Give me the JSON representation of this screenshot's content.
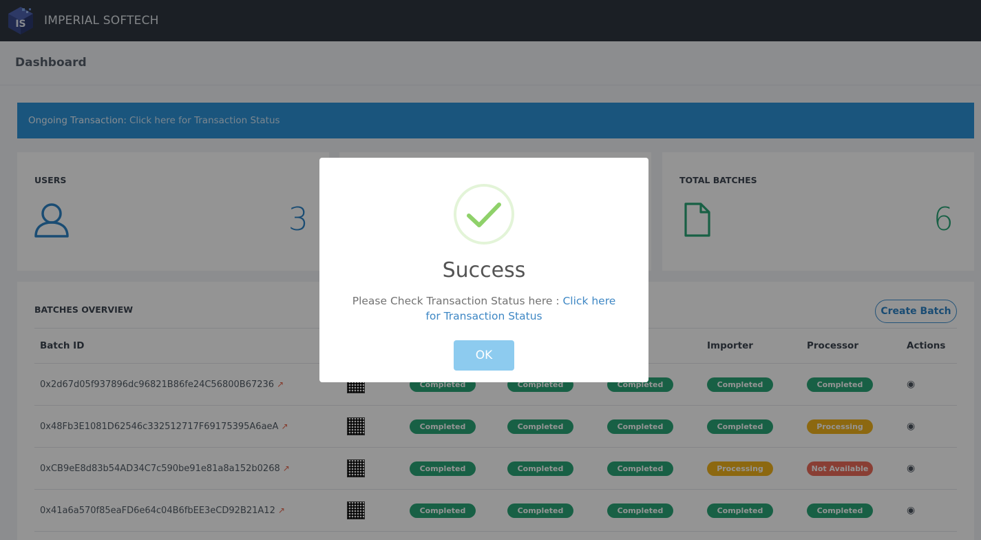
{
  "app": {
    "brand": "IMPERIAL SOFTECH",
    "logo_text": "IS"
  },
  "page": {
    "title": "Dashboard"
  },
  "alert": {
    "label": "Ongoing Transaction:",
    "link": "Click here for Transaction Status"
  },
  "stats": {
    "users": {
      "title": "USERS",
      "value": "3",
      "icon": "user-icon",
      "color": "#2e84c7"
    },
    "batches": {
      "title": "TOTAL BATCHES",
      "value": "6",
      "icon": "file-icon",
      "color": "#2aa578"
    }
  },
  "overview": {
    "title": "BATCHES OVERVIEW",
    "create_label": "Create Batch",
    "columns": [
      "Batch ID",
      "",
      "",
      "",
      "",
      "Importer",
      "Processor",
      "Actions"
    ],
    "rows": [
      {
        "id": "0x2d67d05f937896dc96821B86fe24C56800B67236",
        "s1": "Completed",
        "s2": "Completed",
        "s3": "Completed",
        "s4": "Completed",
        "s5": "Completed"
      },
      {
        "id": "0x48Fb3E1081D62546c332512717F69175395A6aeA",
        "s1": "Completed",
        "s2": "Completed",
        "s3": "Completed",
        "s4": "Completed",
        "s5": "Processing"
      },
      {
        "id": "0xCB9eE8d83b54AD34C7c590be91e81a8a152b0268",
        "s1": "Completed",
        "s2": "Completed",
        "s3": "Completed",
        "s4": "Processing",
        "s5": "Not Available"
      },
      {
        "id": "0x41a6a570f85eaFD6e64c04B6fbEE3eCD92B21A12",
        "s1": "Completed",
        "s2": "Completed",
        "s3": "Completed",
        "s4": "Completed",
        "s5": "Completed"
      }
    ],
    "status_colors": {
      "Completed": "#2aa578",
      "Processing": "#f1b31d",
      "Not Available": "#ec6c5a"
    }
  },
  "modal": {
    "title": "Success",
    "text": "Please Check Transaction Status here :",
    "link": "Click here for Transaction Status",
    "ok_label": "OK"
  }
}
